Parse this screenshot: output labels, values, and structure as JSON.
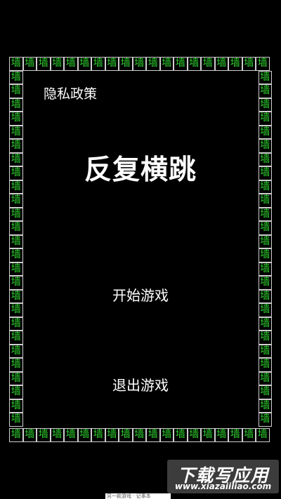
{
  "wall": {
    "tile_char": "墙",
    "tile_color": "#2fd32f",
    "border_color": "#cfcfcf"
  },
  "menu": {
    "privacy_label": "隐私政策",
    "title": "反复横跳",
    "start_label": "开始游戏",
    "exit_label": "退出游戏"
  },
  "watermark": {
    "title": "下载写应用",
    "url": "www.xiazaiiliao.com"
  },
  "bottom_strip": {
    "text": "另一款游戏 · 记事本"
  }
}
